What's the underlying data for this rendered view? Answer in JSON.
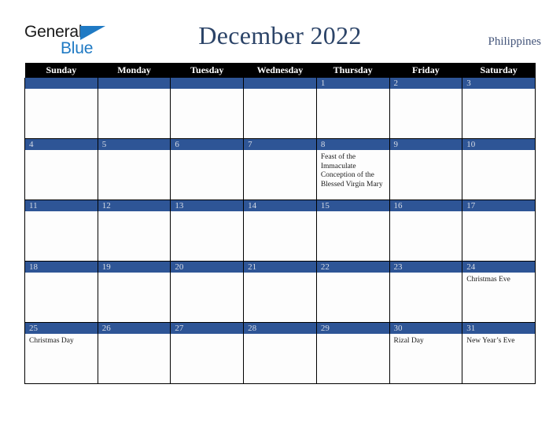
{
  "logo": {
    "word_one": "General",
    "word_two": "Blue",
    "triangle_icon": "triangle-icon",
    "accent_color": "#1f7ac4"
  },
  "header": {
    "title": "December 2022",
    "country": "Philippines",
    "title_color": "#2c4468"
  },
  "calendar": {
    "weekday_headers": [
      "Sunday",
      "Monday",
      "Tuesday",
      "Wednesday",
      "Thursday",
      "Friday",
      "Saturday"
    ],
    "header_bg": "#000000",
    "daybar_bg": "#2e5596",
    "daybar_text_color": "#d7dce6",
    "weeks": [
      [
        {
          "date": "",
          "events": ""
        },
        {
          "date": "",
          "events": ""
        },
        {
          "date": "",
          "events": ""
        },
        {
          "date": "",
          "events": ""
        },
        {
          "date": "1",
          "events": ""
        },
        {
          "date": "2",
          "events": ""
        },
        {
          "date": "3",
          "events": ""
        }
      ],
      [
        {
          "date": "4",
          "events": ""
        },
        {
          "date": "5",
          "events": ""
        },
        {
          "date": "6",
          "events": ""
        },
        {
          "date": "7",
          "events": ""
        },
        {
          "date": "8",
          "events": "Feast of the Immaculate Conception of the Blessed Virgin Mary"
        },
        {
          "date": "9",
          "events": ""
        },
        {
          "date": "10",
          "events": ""
        }
      ],
      [
        {
          "date": "11",
          "events": ""
        },
        {
          "date": "12",
          "events": ""
        },
        {
          "date": "13",
          "events": ""
        },
        {
          "date": "14",
          "events": ""
        },
        {
          "date": "15",
          "events": ""
        },
        {
          "date": "16",
          "events": ""
        },
        {
          "date": "17",
          "events": ""
        }
      ],
      [
        {
          "date": "18",
          "events": ""
        },
        {
          "date": "19",
          "events": ""
        },
        {
          "date": "20",
          "events": ""
        },
        {
          "date": "21",
          "events": ""
        },
        {
          "date": "22",
          "events": ""
        },
        {
          "date": "23",
          "events": ""
        },
        {
          "date": "24",
          "events": "Christmas Eve"
        }
      ],
      [
        {
          "date": "25",
          "events": "Christmas Day"
        },
        {
          "date": "26",
          "events": ""
        },
        {
          "date": "27",
          "events": ""
        },
        {
          "date": "28",
          "events": ""
        },
        {
          "date": "29",
          "events": ""
        },
        {
          "date": "30",
          "events": "Rizal Day"
        },
        {
          "date": "31",
          "events": "New Year’s Eve"
        }
      ]
    ]
  }
}
